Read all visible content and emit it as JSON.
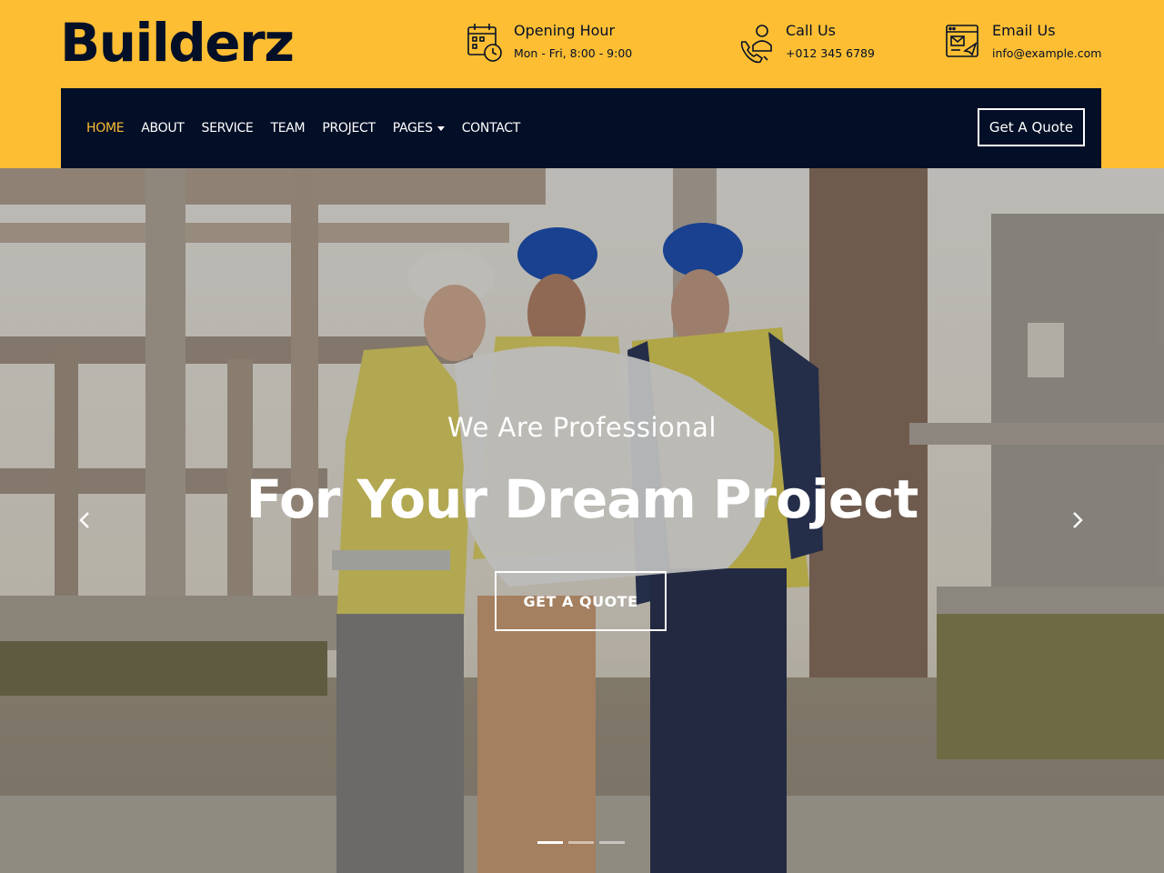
{
  "brand": {
    "logo_text": "Builderz"
  },
  "header_info": {
    "hours": {
      "title": "Opening Hour",
      "value": "Mon - Fri, 8:00 - 9:00"
    },
    "call": {
      "title": "Call Us",
      "value": "+012 345 6789"
    },
    "email": {
      "title": "Email Us",
      "value": "info@example.com"
    }
  },
  "nav": {
    "items": [
      {
        "label": "HOME",
        "active": true
      },
      {
        "label": "ABOUT"
      },
      {
        "label": "SERVICE"
      },
      {
        "label": "TEAM"
      },
      {
        "label": "PROJECT"
      },
      {
        "label": "PAGES",
        "has_dropdown": true
      },
      {
        "label": "CONTACT"
      }
    ],
    "quote_button": "Get A Quote"
  },
  "hero": {
    "subtitle": "We Are Professional",
    "title": "For Your Dream Project",
    "cta": "GET A QUOTE",
    "slide_count": 3,
    "active_slide": 1
  },
  "colors": {
    "accent": "#fdbe33",
    "dark": "#030f27",
    "white": "#ffffff"
  },
  "icons": {
    "hours": "calendar-clock-icon",
    "call": "phone-call-icon",
    "email": "email-icon",
    "prev": "chevron-left-icon",
    "next": "chevron-right-icon"
  }
}
